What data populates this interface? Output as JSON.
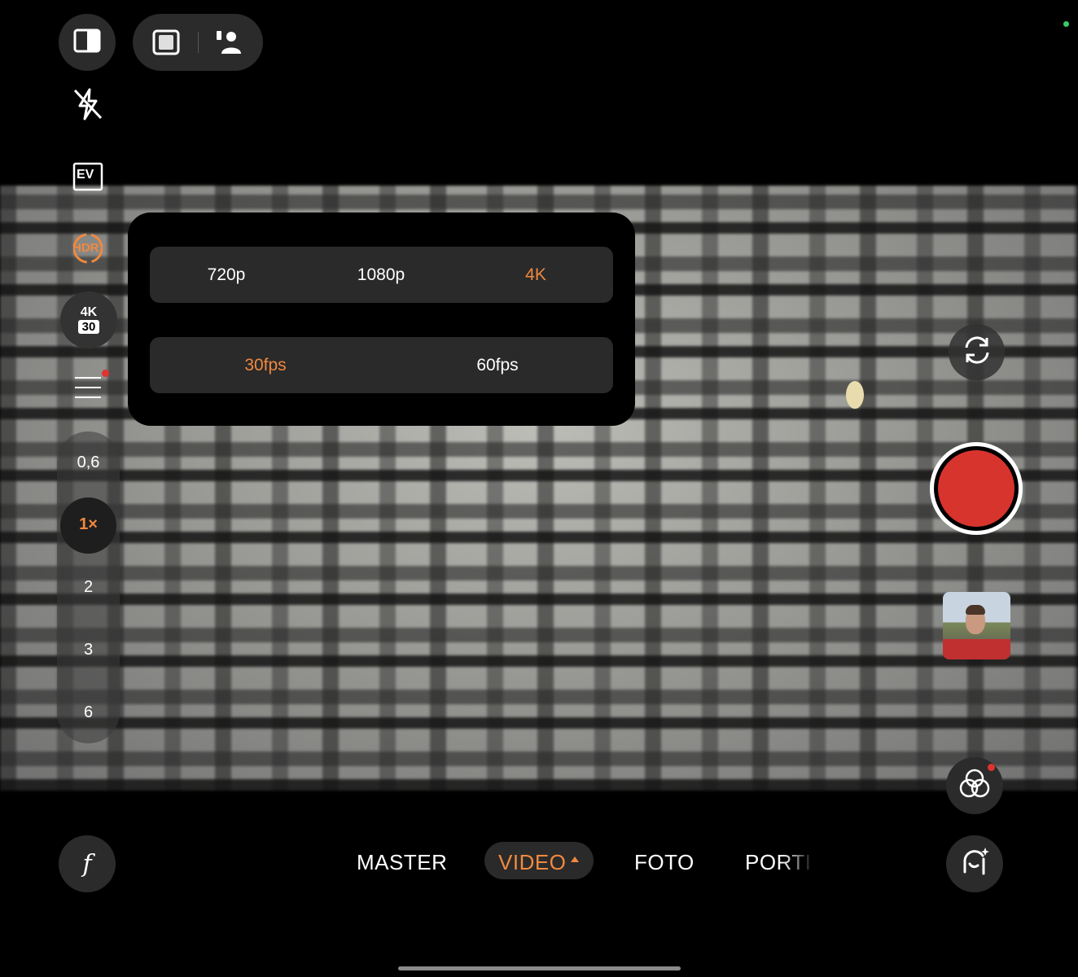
{
  "top_bar": {
    "layout_icon": "split-view-icon",
    "aspect_icon": "frame-aspect-icon",
    "portrait_icon": "person-icon"
  },
  "left_controls": {
    "flash": "flash-off-icon",
    "ev_label": "EV",
    "hdr_label": "HDR",
    "resolution_badge": {
      "top": "4K",
      "bottom": "30"
    },
    "menu_icon": "menu-icon"
  },
  "zoom": {
    "levels": [
      "0,6",
      "1×",
      "2",
      "3",
      "6"
    ],
    "active": "1×"
  },
  "video_settings": {
    "resolutions": [
      "720p",
      "1080p",
      "4K"
    ],
    "selected_resolution": "4K",
    "frame_rates": [
      "30fps",
      "60fps"
    ],
    "selected_frame_rate": "30fps"
  },
  "right_controls": {
    "switch_camera": "switch-camera-icon",
    "record": "record-button",
    "gallery": "gallery-thumbnail",
    "filters": "filters-icon"
  },
  "bottom": {
    "f_label": "f",
    "modes": [
      "MASTER",
      "VIDEO",
      "FOTO",
      "PORTI"
    ],
    "active_mode": "VIDEO",
    "ai_icon": "ai-portrait-icon"
  },
  "colors": {
    "accent": "#f0893f",
    "record": "#d8342e",
    "notification": "#e0332e",
    "status": "#39c96a"
  }
}
